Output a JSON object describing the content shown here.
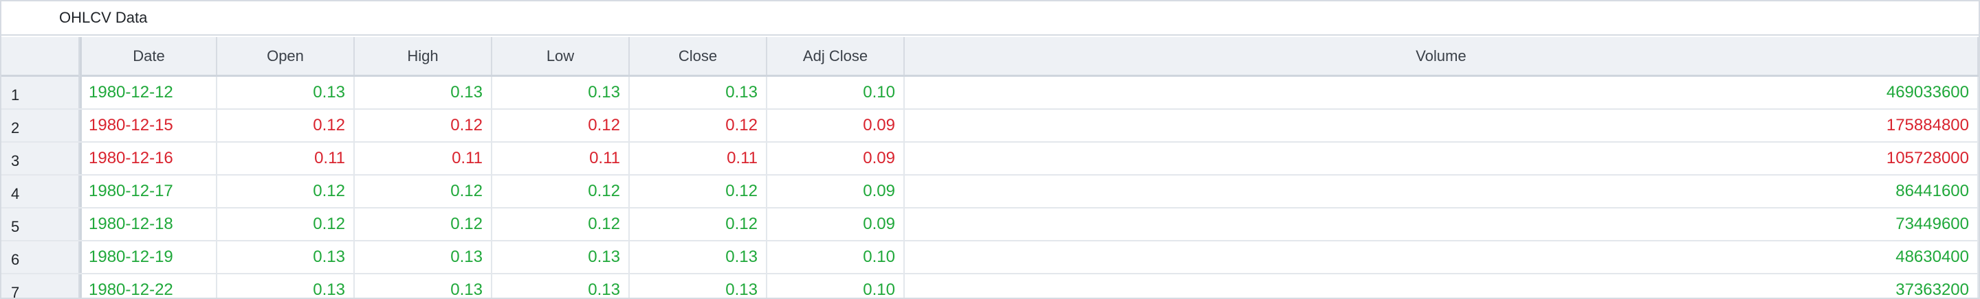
{
  "window": {
    "title": "OHLCV Data"
  },
  "colors": {
    "up": "#1fa83a",
    "down": "#d9232e",
    "header_bg": "#eef1f5"
  },
  "columns": [
    "Date",
    "Open",
    "High",
    "Low",
    "Close",
    "Adj Close",
    "Volume"
  ],
  "rows": [
    {
      "num": "1",
      "trend": "up",
      "date": "1980-12-12",
      "open": "0.13",
      "high": "0.13",
      "low": "0.13",
      "close": "0.13",
      "adj_close": "0.10",
      "volume": "469033600"
    },
    {
      "num": "2",
      "trend": "down",
      "date": "1980-12-15",
      "open": "0.12",
      "high": "0.12",
      "low": "0.12",
      "close": "0.12",
      "adj_close": "0.09",
      "volume": "175884800"
    },
    {
      "num": "3",
      "trend": "down",
      "date": "1980-12-16",
      "open": "0.11",
      "high": "0.11",
      "low": "0.11",
      "close": "0.11",
      "adj_close": "0.09",
      "volume": "105728000"
    },
    {
      "num": "4",
      "trend": "up",
      "date": "1980-12-17",
      "open": "0.12",
      "high": "0.12",
      "low": "0.12",
      "close": "0.12",
      "adj_close": "0.09",
      "volume": "86441600"
    },
    {
      "num": "5",
      "trend": "up",
      "date": "1980-12-18",
      "open": "0.12",
      "high": "0.12",
      "low": "0.12",
      "close": "0.12",
      "adj_close": "0.09",
      "volume": "73449600"
    },
    {
      "num": "6",
      "trend": "up",
      "date": "1980-12-19",
      "open": "0.13",
      "high": "0.13",
      "low": "0.13",
      "close": "0.13",
      "adj_close": "0.10",
      "volume": "48630400"
    },
    {
      "num": "7",
      "trend": "up",
      "date": "1980-12-22",
      "open": "0.13",
      "high": "0.13",
      "low": "0.13",
      "close": "0.13",
      "adj_close": "0.10",
      "volume": "37363200"
    }
  ]
}
